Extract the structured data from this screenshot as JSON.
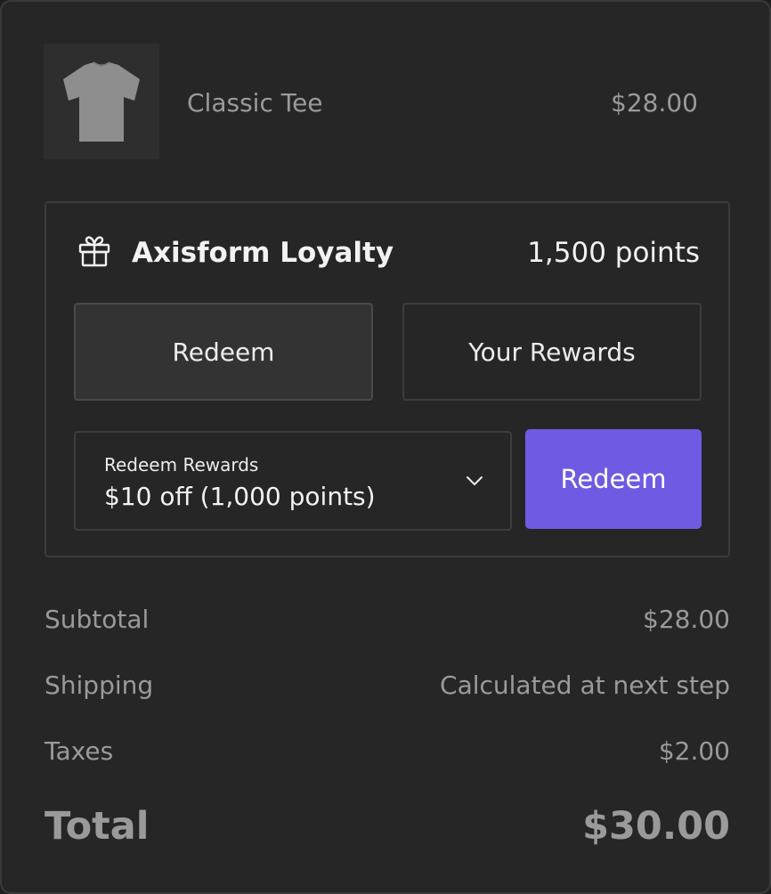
{
  "product": {
    "name": "Classic Tee",
    "price": "$28.00",
    "thumbnail_icon": "t-shirt-icon"
  },
  "loyalty": {
    "icon": "gift-icon",
    "title": "Axisform Loyalty",
    "points": "1,500 points",
    "tabs": [
      {
        "label": "Redeem",
        "active": true
      },
      {
        "label": "Your Rewards",
        "active": false
      }
    ],
    "select": {
      "label": "Redeem Rewards",
      "value": "$10 off (1,000 points)"
    },
    "redeem_button": "Redeem",
    "accent_color": "#6f5be3"
  },
  "summary": {
    "subtotal_label": "Subtotal",
    "subtotal_value": "$28.00",
    "shipping_label": "Shipping",
    "shipping_value": "Calculated at next step",
    "taxes_label": "Taxes",
    "taxes_value": "$2.00",
    "total_label": "Total",
    "total_value": "$30.00"
  }
}
